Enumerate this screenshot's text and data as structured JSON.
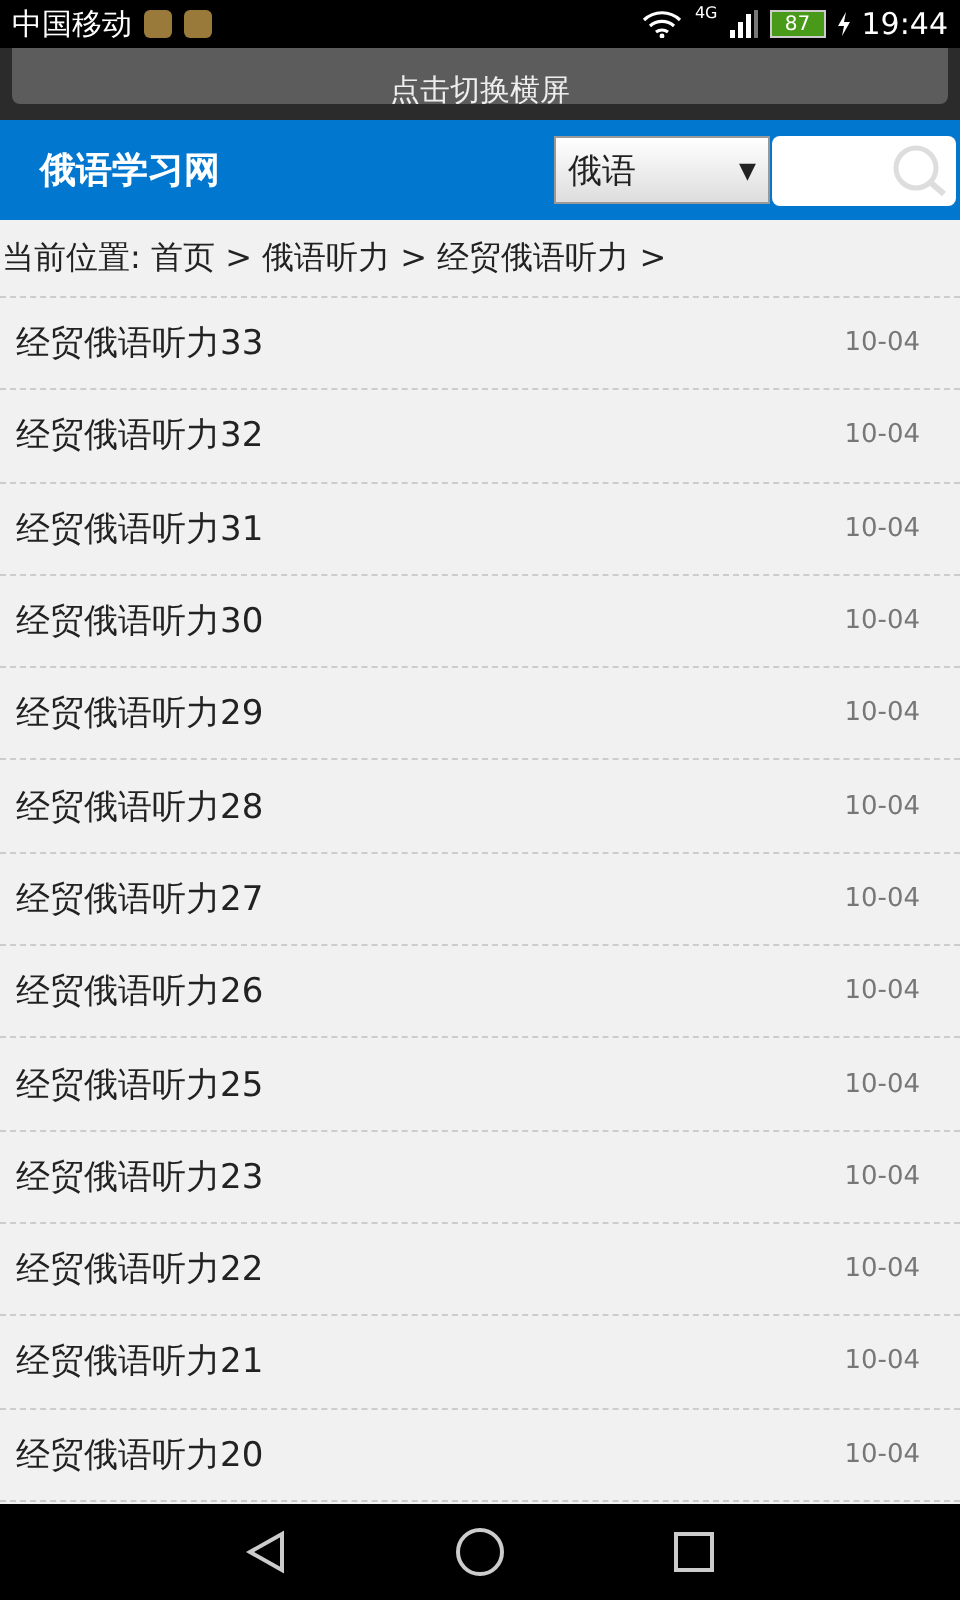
{
  "status_bar": {
    "carrier": "中国移动",
    "network": "4G",
    "battery": "87",
    "time": "19:44"
  },
  "rotate_button": {
    "label": "点击切换横屏"
  },
  "header": {
    "title": "俄语学习网",
    "select": {
      "value": "俄语",
      "arrow": "▼"
    }
  },
  "breadcrumb": "当前位置: 首页 > 俄语听力 > 经贸俄语听力 >",
  "articles": [
    {
      "title": "经贸俄语听力33",
      "date": "10-04"
    },
    {
      "title": "经贸俄语听力32",
      "date": "10-04"
    },
    {
      "title": "经贸俄语听力31",
      "date": "10-04"
    },
    {
      "title": "经贸俄语听力30",
      "date": "10-04"
    },
    {
      "title": "经贸俄语听力29",
      "date": "10-04"
    },
    {
      "title": "经贸俄语听力28",
      "date": "10-04"
    },
    {
      "title": "经贸俄语听力27",
      "date": "10-04"
    },
    {
      "title": "经贸俄语听力26",
      "date": "10-04"
    },
    {
      "title": "经贸俄语听力25",
      "date": "10-04"
    },
    {
      "title": "经贸俄语听力23",
      "date": "10-04"
    },
    {
      "title": "经贸俄语听力22",
      "date": "10-04"
    },
    {
      "title": "经贸俄语听力21",
      "date": "10-04"
    },
    {
      "title": "经贸俄语听力20",
      "date": "10-04"
    }
  ]
}
